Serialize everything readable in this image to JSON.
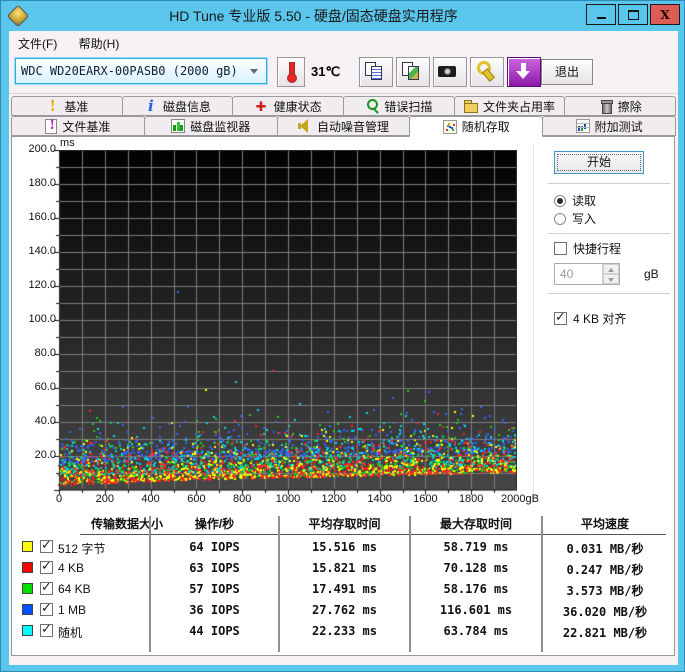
{
  "window": {
    "title": "HD Tune 专业版 5.50 - 硬盘/固态硬盘实用程序"
  },
  "menu": {
    "items": [
      {
        "label": "文件(F)"
      },
      {
        "label": "帮助(H)"
      }
    ]
  },
  "toolbar": {
    "drive_selector": {
      "value": "WDC WD20EARX-00PASB0 (2000 gB)"
    },
    "temperature": "31℃",
    "buttons": [
      {
        "icon": "thermometer-icon"
      },
      {
        "icon": "copy-text-icon"
      },
      {
        "icon": "copy-image-icon"
      },
      {
        "icon": "camera-icon"
      },
      {
        "icon": "options-icon"
      },
      {
        "icon": "update-icon"
      }
    ],
    "exit_label": "退出"
  },
  "tabs": {
    "active": "随机存取",
    "row1": [
      {
        "label": "基准",
        "icon": "benchmark-icon"
      },
      {
        "label": "磁盘信息",
        "icon": "disk-info-icon"
      },
      {
        "label": "健康状态",
        "icon": "health-icon"
      },
      {
        "label": "错误扫描",
        "icon": "error-scan-icon"
      },
      {
        "label": "文件夹占用率",
        "icon": "folder-usage-icon"
      },
      {
        "label": "擦除",
        "icon": "erase-icon"
      }
    ],
    "row2": [
      {
        "label": "文件基准",
        "icon": "file-benchmark-icon"
      },
      {
        "label": "磁盘监视器",
        "icon": "disk-monitor-icon"
      },
      {
        "label": "自动噪音管理",
        "icon": "aam-icon"
      },
      {
        "label": "随机存取",
        "icon": "random-access-icon"
      },
      {
        "label": "附加测试",
        "icon": "extra-tests-icon"
      }
    ]
  },
  "controls": {
    "start_label": "开始",
    "read_label": "读取",
    "write_label": "写入",
    "read_selected": true,
    "write_selected": false,
    "short_stroke_label": "快捷行程",
    "short_stroke_checked": false,
    "short_stroke_value": "40",
    "short_stroke_unit": "gB",
    "align_label": "4 KB 对齐",
    "align_checked": true
  },
  "chart_data": {
    "type": "scatter",
    "title": "随机存取测试散点图",
    "x_axis": {
      "min": 0,
      "max": 2000,
      "unit": "gB",
      "tick_interval": 200,
      "grid_interval": 100,
      "tick_labels": [
        "0",
        "200",
        "400",
        "600",
        "800",
        "1000",
        "1200",
        "1400",
        "1600",
        "1800",
        "2000gB"
      ]
    },
    "y_axis": {
      "min": 0,
      "max": 200,
      "unit": "ms",
      "tick_interval": 20,
      "grid_interval": 10,
      "tick_labels": [
        "200.0",
        "180.0",
        "160.0",
        "140.0",
        "120.0",
        "100.0",
        "80.0",
        "60.0",
        "40.0",
        "20.0"
      ]
    },
    "legend_position": "table-below",
    "grid": true,
    "series": [
      {
        "name": "512 字节",
        "color": "#ffff00",
        "iops": 64,
        "avg_ms": 15.516,
        "max_ms": 58.719,
        "speed_mb_s": 0.031
      },
      {
        "name": "4 KB",
        "color": "#ff2222",
        "iops": 63,
        "avg_ms": 15.821,
        "max_ms": 70.128,
        "speed_mb_s": 0.247
      },
      {
        "name": "64 KB",
        "color": "#22cc22",
        "iops": 57,
        "avg_ms": 17.491,
        "max_ms": 58.176,
        "speed_mb_s": 3.573
      },
      {
        "name": "1 MB",
        "color": "#3366ff",
        "iops": 36,
        "avg_ms": 27.762,
        "max_ms": 116.601,
        "speed_mb_s": 36.02
      },
      {
        "name": "随机",
        "color": "#00dddd",
        "iops": 44,
        "avg_ms": 22.233,
        "max_ms": 63.784,
        "speed_mb_s": 22.821
      }
    ]
  },
  "table": {
    "headers": [
      "传输数据大小",
      "操作/秒",
      "平均存取时间",
      "最大存取时间",
      "平均速度"
    ],
    "rows": [
      {
        "color": "#ffff00",
        "checked": true,
        "label": "512 字节",
        "iops": "64 IOPS",
        "avg": "15.516 ms",
        "max": "58.719 ms",
        "speed": "0.031 MB/秒"
      },
      {
        "color": "#ff0000",
        "checked": true,
        "label": "4 KB",
        "iops": "63 IOPS",
        "avg": "15.821 ms",
        "max": "70.128 ms",
        "speed": "0.247 MB/秒"
      },
      {
        "color": "#00e000",
        "checked": true,
        "label": "64 KB",
        "iops": "57 IOPS",
        "avg": "17.491 ms",
        "max": "58.176 ms",
        "speed": "3.573 MB/秒"
      },
      {
        "color": "#0050ff",
        "checked": true,
        "label": "1 MB",
        "iops": "36 IOPS",
        "avg": "27.762 ms",
        "max": "116.601 ms",
        "speed": "36.020 MB/秒"
      },
      {
        "color": "#00ffff",
        "checked": true,
        "label": "随机",
        "iops": "44 IOPS",
        "avg": "22.233 ms",
        "max": "63.784 ms",
        "speed": "22.821 MB/秒"
      }
    ]
  }
}
